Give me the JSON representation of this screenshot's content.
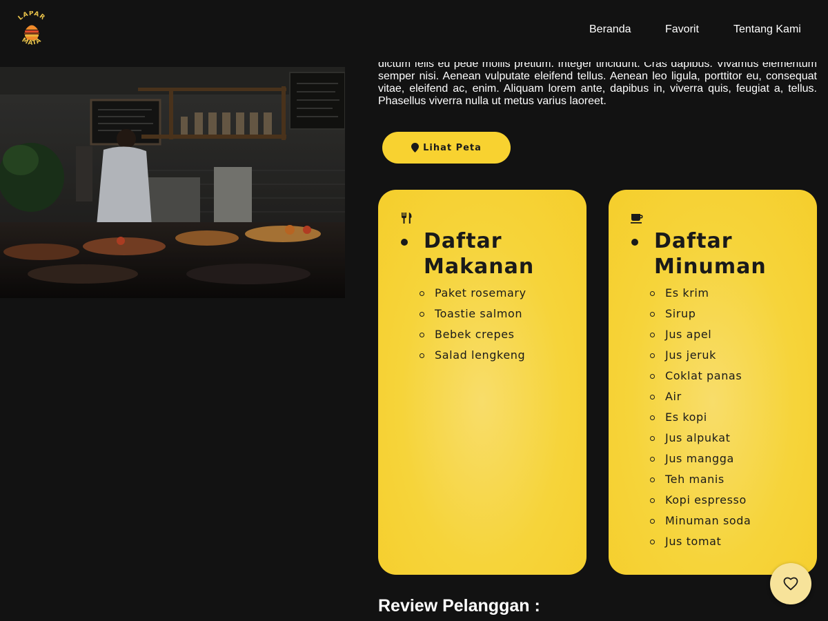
{
  "header": {
    "logo": {
      "text_top": "LAPAR",
      "text_bottom": "MATA",
      "icon": "burger-logo"
    },
    "nav": [
      {
        "label": "Beranda"
      },
      {
        "label": "Favorit"
      },
      {
        "label": "Tentang Kami"
      }
    ]
  },
  "hero": {
    "photo": {
      "subject": "restaurant-kitchen-photo"
    },
    "intro_text": "Lorem ipsum dolor sit amet, consectetuer adipiscing elit. Aenean commodo ligula eget dolor. Aenean massa. Cum sociis natoque penatibus et magnis dis parturient montes, nascetur ridiculus mus. Donec quam felis, ultricies nec, pellentesque eu, pretium quis, sem. Nulla consequat massa quis enim. Donec pede justo, fringilla vel, aliquet nec, vulputate eget, arcu. In enim justo, rhoncus ut, imperdiet a, venenatis vitae, justo. Nullam dictum felis eu pede mollis pretium. Integer tincidunt. Cras dapibus. Vivamus elementum semper nisi. Aenean vulputate eleifend tellus. Aenean leo ligula, porttitor eu, consequat vitae, eleifend ac, enim. Aliquam lorem ante, dapibus in, viverra quis, feugiat a, tellus. Phasellus viverra nulla ut metus varius laoreet.",
    "map_button": {
      "label": "Lihat Peta",
      "icon": "map-pin-icon"
    }
  },
  "menu": {
    "food": {
      "icon": "fork-knife-icon",
      "title": "Daftar Makanan",
      "items": [
        "Paket rosemary",
        "Toastie salmon",
        "Bebek crepes",
        "Salad lengkeng"
      ]
    },
    "drink": {
      "icon": "coffee-cup-icon",
      "title": "Daftar Minuman",
      "items": [
        "Es krim",
        "Sirup",
        "Jus apel",
        "Jus jeruk",
        "Coklat panas",
        "Air",
        "Es kopi",
        "Jus alpukat",
        "Jus mangga",
        "Teh manis",
        "Kopi espresso",
        "Minuman soda",
        "Jus tomat"
      ]
    }
  },
  "reviews": {
    "heading": "Review Pelanggan :"
  },
  "favorite_button": {
    "icon": "heart-icon"
  },
  "colors": {
    "background": "#121212",
    "accent": "#f8d230",
    "text_light": "#ffffff",
    "text_dark": "#1a1a1a"
  }
}
